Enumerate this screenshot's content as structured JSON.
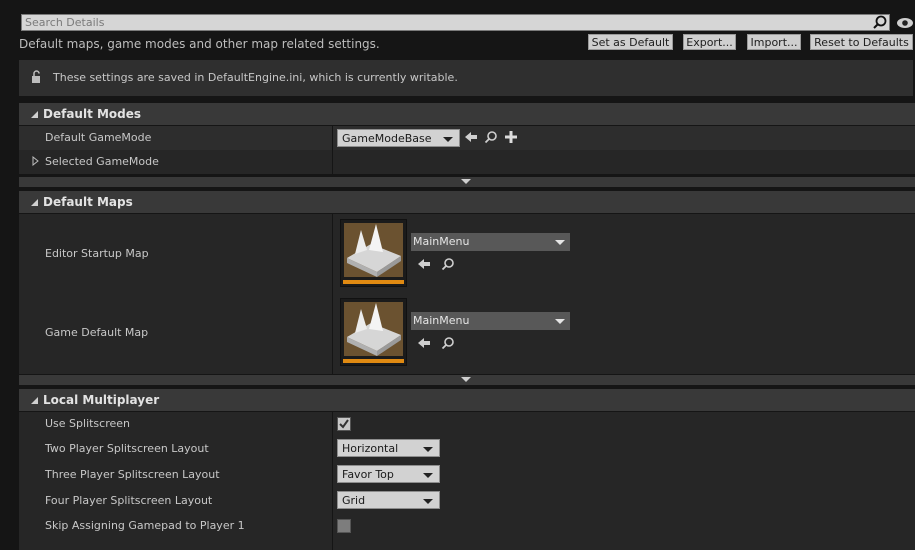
{
  "search": {
    "placeholder": "Search Details",
    "value": ""
  },
  "description": "Default maps, game modes and other map related settings.",
  "toolbar": {
    "set_as_default": "Set as Default",
    "export": "Export...",
    "import": "Import...",
    "reset": "Reset to Defaults"
  },
  "notice": "These settings are saved in DefaultEngine.ini, which is currently writable.",
  "sections": {
    "default_modes": {
      "title": "Default Modes",
      "default_gamemode_label": "Default GameMode",
      "default_gamemode_value": "GameModeBase",
      "selected_gamemode_label": "Selected GameMode"
    },
    "default_maps": {
      "title": "Default Maps",
      "editor_startup_label": "Editor Startup Map",
      "editor_startup_value": "MainMenu",
      "game_default_label": "Game Default Map",
      "game_default_value": "MainMenu"
    },
    "local_multiplayer": {
      "title": "Local Multiplayer",
      "use_splitscreen_label": "Use Splitscreen",
      "use_splitscreen_checked": true,
      "two_player_label": "Two Player Splitscreen Layout",
      "two_player_value": "Horizontal",
      "three_player_label": "Three Player Splitscreen Layout",
      "three_player_value": "Favor Top",
      "four_player_label": "Four Player Splitscreen Layout",
      "four_player_value": "Grid",
      "skip_gamepad_label": "Skip Assigning Gamepad to Player 1",
      "skip_gamepad_checked": false
    }
  },
  "colors": {
    "accent": "#e08a12",
    "panel": "#262626",
    "header": "#393939"
  }
}
